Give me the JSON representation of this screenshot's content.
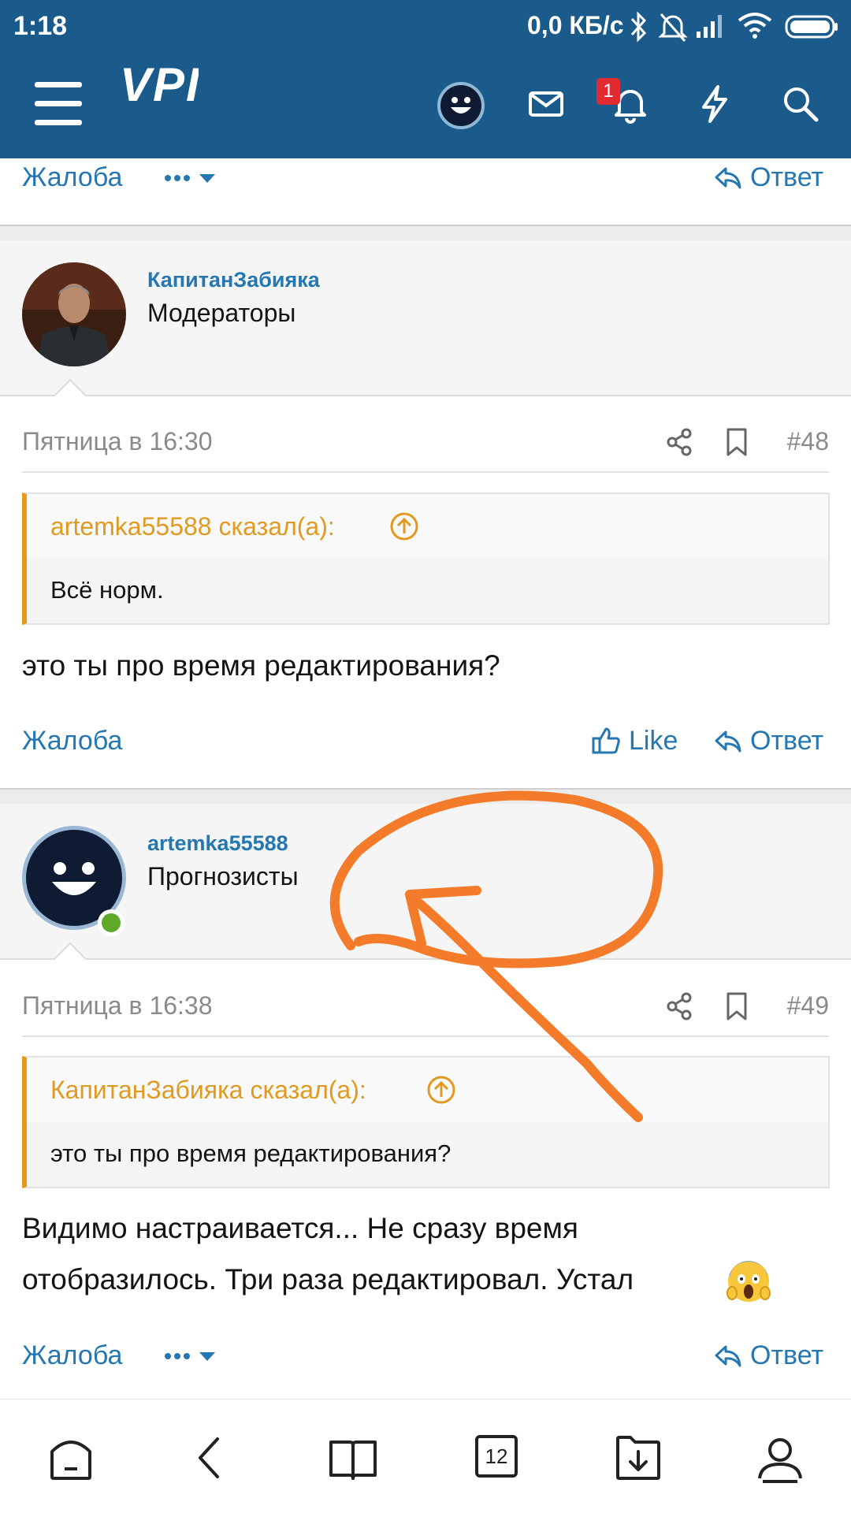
{
  "status_bar": {
    "time": "1:18",
    "speed": "0,0 КБ/с"
  },
  "header": {
    "logo": "VPI",
    "notifications_count": "1"
  },
  "post_prev": {
    "report": "Жалоба",
    "reply": "Ответ"
  },
  "post48": {
    "author": "КапитанЗабияка",
    "role": "Модераторы",
    "date": "Пятница в 16:30",
    "number": "#48",
    "quote_header": "artemka55588 сказал(а):",
    "quote_text": "Всё норм.",
    "message": "это ты про время редактирования?",
    "report": "Жалоба",
    "like": "Like",
    "reply": "Ответ"
  },
  "post49": {
    "author": "artemka55588",
    "role": "Прогнозисты",
    "date": "Пятница в 16:38",
    "number": "#49",
    "quote_header": "КапитанЗабияка сказал(а):",
    "quote_text": "это ты про время редактирования?",
    "message_line1": "Видимо настраивается... Не сразу время",
    "message_line2": "отобразилось. Три раза редактировал. Устал",
    "report": "Жалоба",
    "reply": "Ответ"
  },
  "bottom_nav": {
    "tabs_count": "12"
  },
  "colors": {
    "header": "#1b5b8b",
    "link": "#2577b1",
    "quote_accent": "#e9981c",
    "annotation": "#f47b2a"
  }
}
